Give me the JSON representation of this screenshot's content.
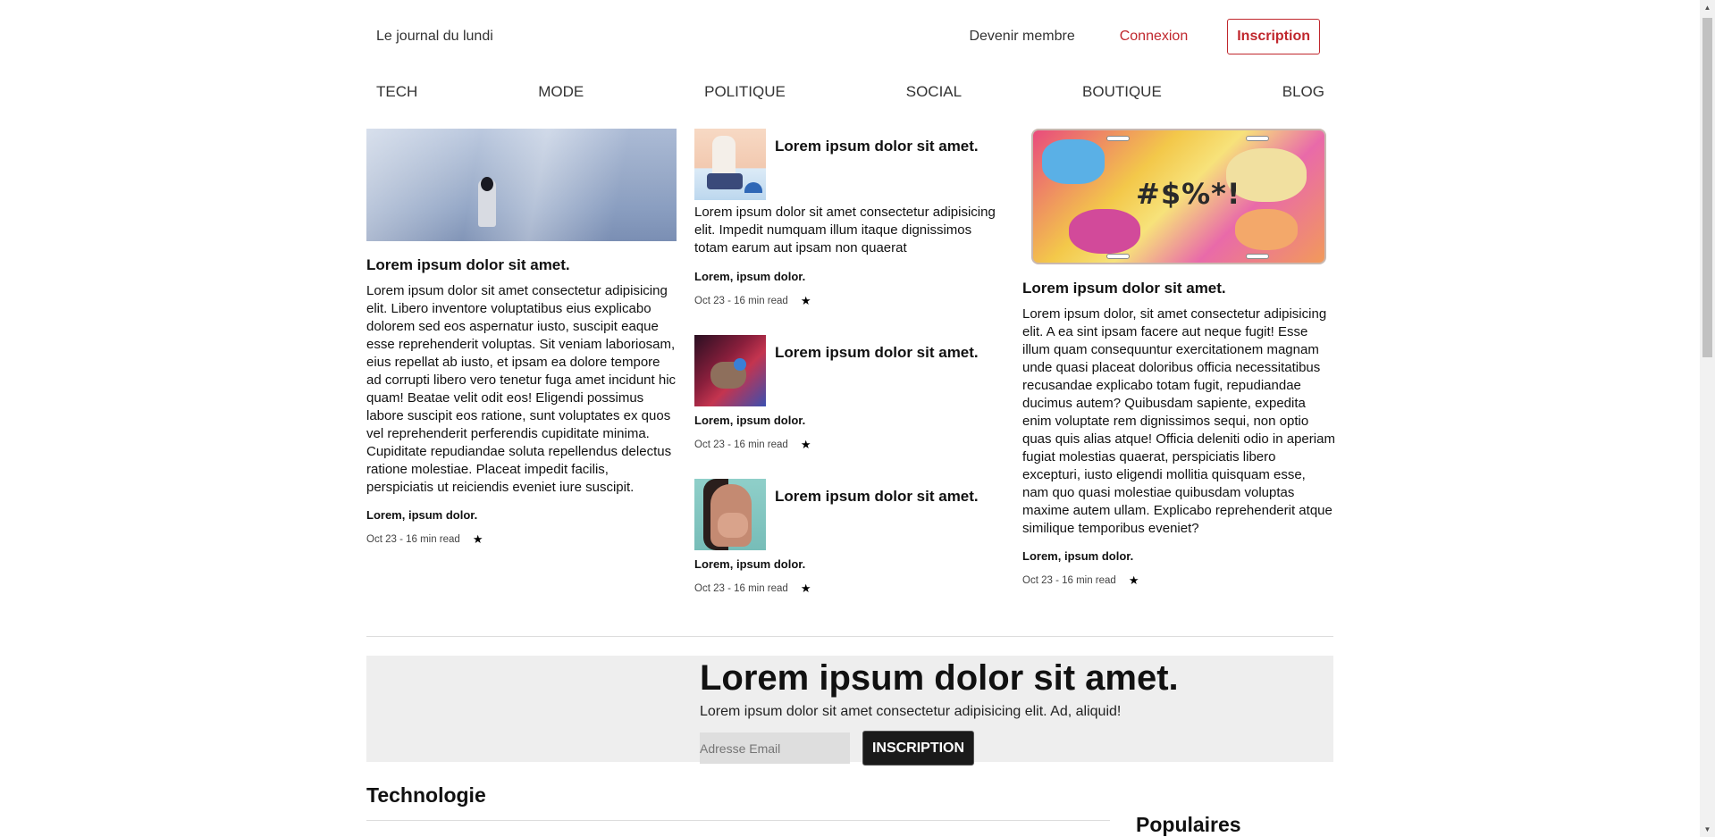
{
  "header": {
    "brand": "Le journal du lundi",
    "member_link": "Devenir membre",
    "login_link": "Connexion",
    "signup_button": "Inscription"
  },
  "nav": {
    "items": [
      "TECH",
      "MODE",
      "POLITIQUE",
      "SOCIAL",
      "BOUTIQUE",
      "BLOG"
    ]
  },
  "articles": {
    "main": {
      "title": "Lorem ipsum dolor sit amet.",
      "text": "Lorem ipsum dolor sit amet consectetur adipisicing elit. Libero inventore voluptatibus eius explicabo dolorem sed eos aspernatur iusto, suscipit eaque esse reprehenderit voluptas. Sit veniam laboriosam, eius repellat ab iusto, et ipsam ea dolore tempore ad corrupti libero vero tenetur fuga amet incidunt hic quam! Beatae velit odit eos! Eligendi possimus labore suscipit eos ratione, sunt voluptates ex quos vel reprehenderit perferendis cupiditate minima. Cupiditate repudiandae soluta repellendus delectus ratione molestiae. Placeat impedit facilis, perspiciatis ut reiciendis eveniet iure suscipit.",
      "author": "Lorem, ipsum dolor.",
      "meta": "Oct 23 - 16 min read"
    },
    "side": [
      {
        "title": "Lorem ipsum dolor sit amet.",
        "text": "Lorem ipsum dolor sit amet consectetur adipisicing elit. Impedit numquam illum itaque dignissimos totam earum aut ipsam non quaerat",
        "author": "Lorem, ipsum dolor.",
        "meta": "Oct 23 - 16 min read"
      },
      {
        "title": "Lorem ipsum dolor sit amet.",
        "author": "Lorem, ipsum dolor.",
        "meta": "Oct 23 - 16 min read"
      },
      {
        "title": "Lorem ipsum dolor sit amet.",
        "author": "Lorem, ipsum dolor.",
        "meta": "Oct 23 - 16 min read"
      }
    ],
    "right": {
      "plate_text": "#$%*!",
      "title": "Lorem ipsum dolor sit amet.",
      "text": "Lorem ipsum dolor, sit amet consectetur adipisicing elit. A ea sint ipsam facere aut neque fugit! Esse illum quam consequuntur exercitationem magnam unde quasi placeat doloribus officia necessitatibus recusandae explicabo totam fugit, repudiandae ducimus autem? Quibusdam sapiente, expedita enim voluptate rem dignissimos sequi, non optio quas quis alias atque! Officia deleniti odio in aperiam fugiat molestias quaerat, perspiciatis libero excepturi, iusto eligendi mollitia quisquam esse, nam quo quasi molestiae quibusdam voluptas maxime autem ullam. Explicabo reprehenderit atque similique temporibus eveniet?",
      "author": "Lorem, ipsum dolor.",
      "meta": "Oct 23 - 16 min read"
    },
    "star_icon": "star-icon"
  },
  "newsletter": {
    "title": "Lorem ipsum dolor sit amet.",
    "text": "Lorem ipsum dolor sit amet consectetur adipisicing elit. Ad, aliquid!",
    "email_placeholder": "Adresse Email",
    "button": "INSCRIPTION"
  },
  "sections": {
    "tech": "Technologie",
    "popular": "Populaires"
  },
  "colors": {
    "accent": "#c0272d",
    "newsletter_bg": "#eeeeee",
    "button_dark": "#1a1a1a"
  }
}
